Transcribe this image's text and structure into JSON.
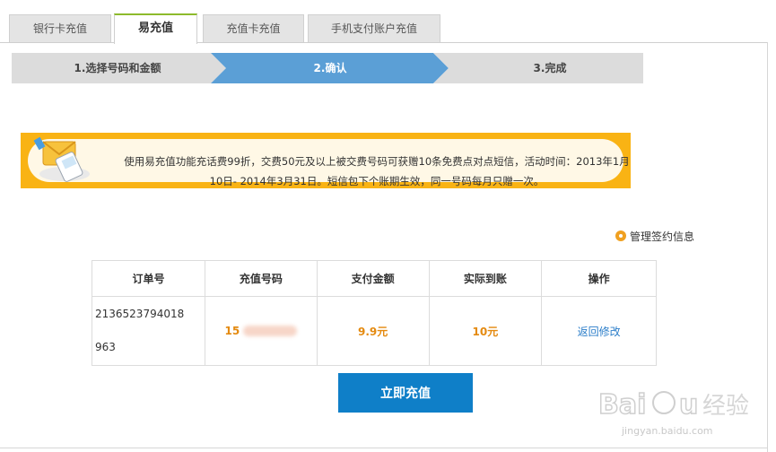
{
  "tabs": [
    {
      "label": "银行卡充值",
      "active": false
    },
    {
      "label": "易充值",
      "active": true
    },
    {
      "label": "充值卡充值",
      "active": false
    },
    {
      "label": "手机支付账户充值",
      "active": false
    }
  ],
  "steps": [
    {
      "label": "1.选择号码和金额",
      "state": "done"
    },
    {
      "label": "2.确认",
      "state": "current"
    },
    {
      "label": "3.完成",
      "state": "todo"
    }
  ],
  "colors": {
    "step_current": "#5b9fd6",
    "step_other": "#dcdcdc",
    "banner": "#f9b314",
    "accent_orange": "#e48a10",
    "link_blue": "#2c7ec9",
    "button_blue": "#0f7fc8",
    "tab_active_border": "#8dbb2c"
  },
  "banner": {
    "icon": "envelope-phone-icon",
    "text": "使用易充值功能充话费99折，交费50元及以上被交费号码可获赠10条免费点对点短信，活动时间：2013年1月10日- 2014年3月31日。短信包下个账期生效，同一号码每月只赠一次。"
  },
  "manage_link": {
    "icon": "gear-icon",
    "label": "管理签约信息"
  },
  "order_table": {
    "headers": [
      "订单号",
      "充值号码",
      "支付金额",
      "实际到账",
      "操作"
    ],
    "rows": [
      {
        "order_id_line1": "2136523794018",
        "order_id_line2": "963",
        "phone_visible": "15",
        "phone_masked": true,
        "pay_amount": "9.9元",
        "actual_amount": "10元",
        "action": "返回修改"
      }
    ]
  },
  "submit_button": "立即充值",
  "watermark": {
    "brand": "Baidu经验",
    "url": "jingyan.baidu.com"
  }
}
